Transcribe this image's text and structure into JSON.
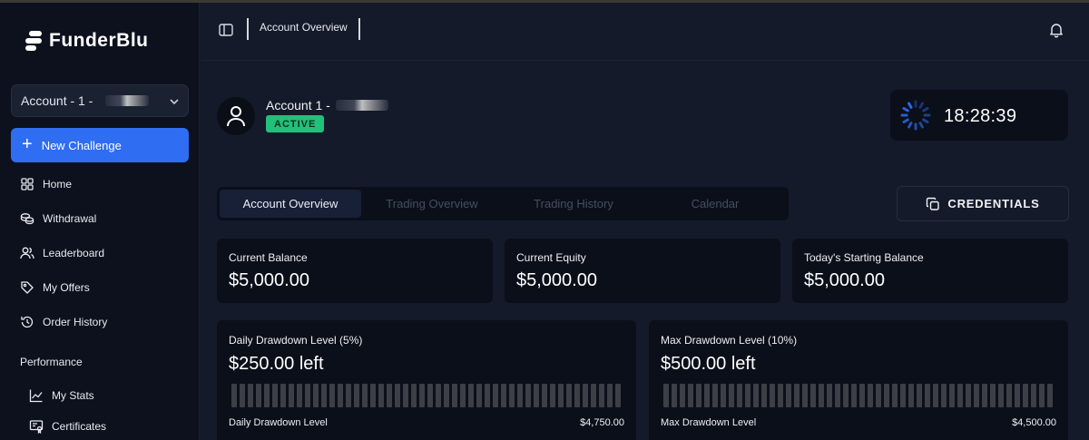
{
  "brand": {
    "name": "FunderBlu"
  },
  "account_selector": {
    "label": "Account - 1 -"
  },
  "sidebar": {
    "new_challenge_label": "New Challenge",
    "items": [
      {
        "label": "Home",
        "icon": "grid-icon"
      },
      {
        "label": "Withdrawal",
        "icon": "coins-icon"
      },
      {
        "label": "Leaderboard",
        "icon": "users-icon"
      },
      {
        "label": "My Offers",
        "icon": "tag-icon"
      },
      {
        "label": "Order History",
        "icon": "history-icon"
      }
    ],
    "section_performance": "Performance",
    "performance_items": [
      {
        "label": "My Stats",
        "icon": "chart-line-icon"
      },
      {
        "label": "Certificates",
        "icon": "certificate-icon"
      }
    ]
  },
  "header": {
    "breadcrumb": "Account Overview"
  },
  "account": {
    "name": "Account 1 -",
    "status": "ACTIVE"
  },
  "clock": {
    "time": "18:28:39"
  },
  "tabs": [
    {
      "label": "Account Overview",
      "active": true
    },
    {
      "label": "Trading Overview",
      "active": false
    },
    {
      "label": "Trading History",
      "active": false
    },
    {
      "label": "Calendar",
      "active": false
    }
  ],
  "credentials_button": {
    "label": "CREDENTIALS"
  },
  "stats": [
    {
      "label": "Current Balance",
      "value": "$5,000.00"
    },
    {
      "label": "Current Equity",
      "value": "$5,000.00"
    },
    {
      "label": "Today's Starting Balance",
      "value": "$5,000.00"
    }
  ],
  "drawdowns": [
    {
      "title": "Daily Drawdown Level (5%)",
      "remaining": "$250.00 left",
      "footer_label": "Daily Drawdown Level",
      "footer_value": "$4,750.00",
      "used_fraction": 0
    },
    {
      "title": "Max Drawdown Level (10%)",
      "remaining": "$500.00 left",
      "footer_label": "Max Drawdown Level",
      "footer_value": "$4,500.00",
      "used_fraction": 0
    }
  ],
  "colors": {
    "accent": "#2f6df2",
    "status_active": "#22c07a",
    "background": "#141a29",
    "card": "#0b0f1a",
    "sidebar": "#0c111d",
    "bar_inactive": "#3c3f46"
  }
}
